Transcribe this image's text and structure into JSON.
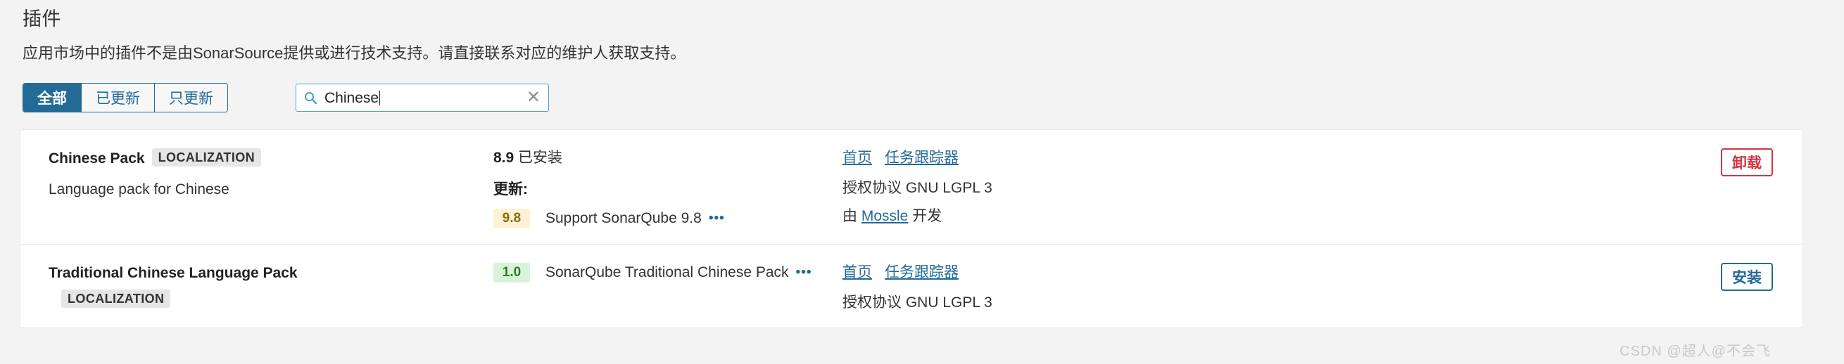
{
  "header": {
    "title": "插件",
    "subtitle": "应用市场中的插件不是由SonarSource提供或进行技术支持。请直接联系对应的维护人获取支持。"
  },
  "filters": {
    "tabs": [
      {
        "label": "全部",
        "active": true
      },
      {
        "label": "已更新",
        "active": false
      },
      {
        "label": "只更新",
        "active": false
      }
    ]
  },
  "search": {
    "value": "Chinese",
    "placeholder": "Search",
    "icon": "search-icon",
    "clear_icon": "✕"
  },
  "plugins": [
    {
      "name": "Chinese Pack",
      "tag": "LOCALIZATION",
      "description": "Language pack for Chinese",
      "installed_version": "8.9",
      "installed_label": "已安装",
      "updates_label": "更新:",
      "update_version": "9.8",
      "update_version_style": "amber",
      "update_text": "Support SonarQube 9.8",
      "ellipsis": "•••",
      "links": [
        {
          "label": "首页"
        },
        {
          "label": "任务跟踪器"
        }
      ],
      "license": "授权协议 GNU LGPL 3",
      "author_prefix": "由",
      "author": "Mossle",
      "author_suffix": "开发",
      "action_label": "卸载",
      "action_style": "danger"
    },
    {
      "name": "Traditional Chinese Language Pack",
      "tag": "LOCALIZATION",
      "description": "",
      "installed_version": "",
      "installed_label": "",
      "updates_label": "",
      "update_version": "1.0",
      "update_version_style": "green",
      "update_text": "SonarQube Traditional Chinese Pack",
      "ellipsis": "•••",
      "links": [
        {
          "label": "首页"
        },
        {
          "label": "任务跟踪器"
        }
      ],
      "license": "授权协议 GNU LGPL 3",
      "author_prefix": "",
      "author": "",
      "author_suffix": "",
      "action_label": "安装",
      "action_style": "primary"
    }
  ],
  "watermark": "CSDN @超人@不会飞",
  "colors": {
    "accent": "#236a97",
    "link": "#236a97",
    "danger": "#d4333f",
    "search_border": "#4b9fd5",
    "page_bg": "#f3f3f3",
    "card_bg": "#ffffff"
  }
}
